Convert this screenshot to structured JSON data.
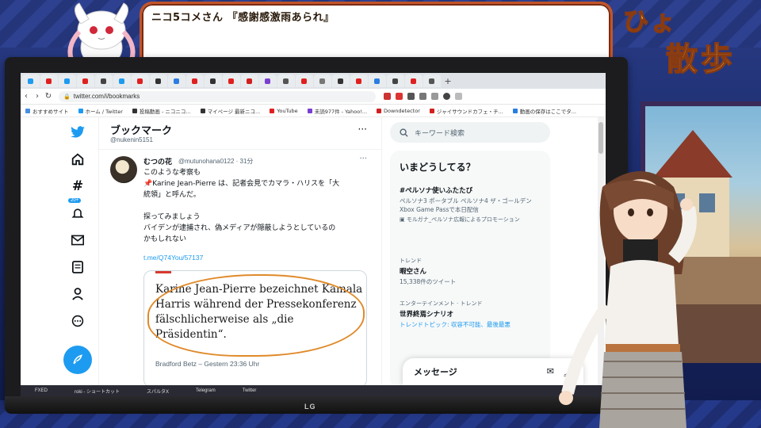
{
  "comment": {
    "text": "ニコ5コメさん 『感謝感激雨あられ』"
  },
  "title_art": {
    "line1": "ひょ",
    "line2": "散歩"
  },
  "browser": {
    "tabs": [
      "",
      "",
      "",
      "",
      "",
      "",
      "",
      "",
      "",
      "",
      "",
      "",
      "",
      "",
      "",
      "",
      "",
      "",
      "",
      "",
      "",
      "",
      ""
    ],
    "url": "twitter.com/i/bookmarks",
    "bookmarks": [
      {
        "label": "おすすめサイト",
        "color": "#4a8fe2"
      },
      {
        "label": "ホーム / Twitter",
        "color": "#1d9bf0"
      },
      {
        "label": "投稿動画 - ニコニコ...",
        "color": "#333333"
      },
      {
        "label": "マイページ 最新ニコ...",
        "color": "#333333"
      },
      {
        "label": "YouTube",
        "color": "#e02020"
      },
      {
        "label": "未読977件 - Yahoo!...",
        "color": "#7b3fd0"
      },
      {
        "label": "Downdetector",
        "color": "#d02020"
      },
      {
        "label": "ジャイサウンドカフェ・チ...",
        "color": "#d02020"
      },
      {
        "label": "動画の保存はここでタ...",
        "color": "#2a7de1"
      }
    ]
  },
  "twitter": {
    "page_title": "ブックマーク",
    "page_handle": "@nukenin5151",
    "notification_badge": "20+",
    "tweet": {
      "name": "むつの花",
      "handle": "@mutunohana0122 · 31分",
      "lines": [
        "このような考察も",
        "📌Karine Jean-Pierre は、記者会見でカマラ・ハリスを「大",
        "統領」と呼んだ。",
        "",
        "探ってみましょう",
        "バイデンが逮捕され、偽メディアが隠蔽しようとしているの",
        "かもしれない"
      ],
      "link": "t.me/Q74You/57137",
      "card_headline": "Karine Jean-Pierre bezeichnet Kamala Harris während der Pressekonferenz fälschlicherweise als „die Präsidentin“.",
      "card_byline": "Bradford Betz – Gestern 23:36 Uhr"
    },
    "search_placeholder": "キーワード検索",
    "trends_title": "いまどうしてる？",
    "trends": [
      {
        "meta": "",
        "name": "#ペルソナ使いふたたび",
        "desc": "ペルソナ3 ポータブル ペルソナ4 ザ・ゴールデン Xbox Game Passで本日配信",
        "promo": "モルガナ_ペルソナ広報によるプロモーション"
      },
      {
        "meta": "トレンド",
        "name": "暇空さん",
        "desc": "15,338件のツイート",
        "promo": ""
      },
      {
        "meta": "エンターテインメント · トレンド",
        "name": "世界終焉シナリオ",
        "desc": "トレンドトピック: 収容不可能、最後最悪",
        "promo": ""
      }
    ],
    "messages_label": "メッセージ"
  },
  "taskbar": [
    "FXED",
    "roki - ショートカット",
    "スパルタX",
    "Telegram",
    "Twitter"
  ],
  "monitor_brand": "LG",
  "colors": {
    "twitter_blue": "#1d9bf0",
    "comment_border": "#c2552a"
  }
}
